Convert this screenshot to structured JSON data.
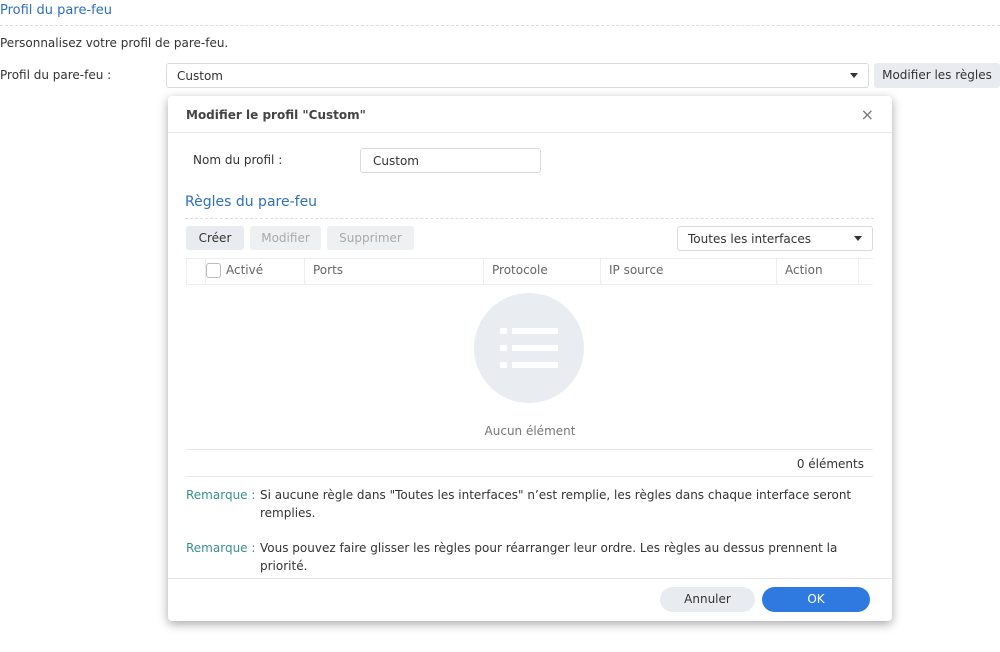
{
  "page": {
    "section_title": "Profil du pare-feu",
    "description": "Personnalisez votre profil de pare-feu.",
    "profile_label": "Profil du pare-feu :",
    "profile_value": "Custom",
    "edit_rules_button": "Modifier les règles"
  },
  "dialog": {
    "title": "Modifier le profil \"Custom\"",
    "close": "×",
    "name_label": "Nom du profil :",
    "name_value": "Custom",
    "rules_title": "Règles du pare-feu",
    "toolbar": {
      "create": "Créer",
      "edit": "Modifier",
      "delete": "Supprimer",
      "interface_select": "Toutes les interfaces"
    },
    "columns": [
      "Activé",
      "Ports",
      "Protocole",
      "IP source",
      "Action"
    ],
    "empty_text": "Aucun élément",
    "count": "0 éléments",
    "notes": [
      {
        "label": "Remarque :",
        "text": "Si aucune règle dans \"Toutes les interfaces\" n’est remplie, les règles dans chaque interface seront remplies."
      },
      {
        "label": "Remarque :",
        "text": "Vous pouvez faire glisser les règles pour réarranger leur ordre. Les règles au dessus prennent la priorité."
      }
    ],
    "cancel": "Annuler",
    "ok": "OK"
  }
}
